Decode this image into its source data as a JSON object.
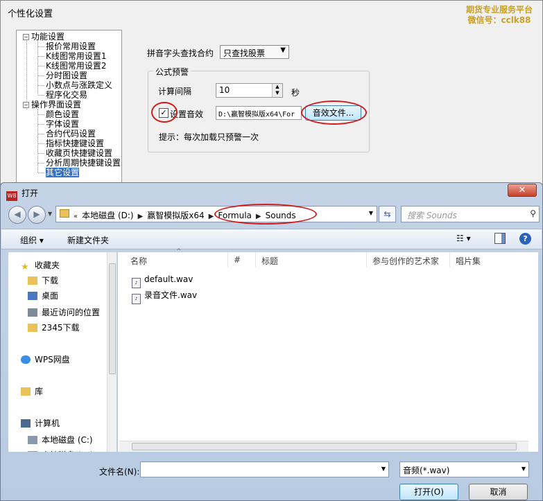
{
  "settings_window": {
    "title": "个性化设置",
    "watermark_line1": "期货专业服务平台",
    "watermark_line2": "微信号：cclk88",
    "tree": [
      {
        "label": "功能设置",
        "level": 0,
        "expander": "−"
      },
      {
        "label": "报价常用设置",
        "level": 1
      },
      {
        "label": "K线图常用设置1",
        "level": 1
      },
      {
        "label": "K线图常用设置2",
        "level": 1
      },
      {
        "label": "分时图设置",
        "level": 1
      },
      {
        "label": "小数点与涨跌定义",
        "level": 1
      },
      {
        "label": "程序化交易",
        "level": 1
      },
      {
        "label": "操作界面设置",
        "level": 0,
        "expander": "−"
      },
      {
        "label": "颜色设置",
        "level": 1
      },
      {
        "label": "字体设置",
        "level": 1
      },
      {
        "label": "合约代码设置",
        "level": 1
      },
      {
        "label": "指标快捷键设置",
        "level": 1
      },
      {
        "label": "收藏页快捷键设置",
        "level": 1
      },
      {
        "label": "分析周期快捷键设置",
        "level": 1
      },
      {
        "label": "其它设置",
        "level": 1,
        "selected": true
      }
    ],
    "pinyin_label": "拼音字头查找合约",
    "pinyin_value": "只查找股票",
    "formula_group": "公式预警",
    "interval_label": "计算间隔",
    "interval_value": "10",
    "interval_unit": "秒",
    "sound_checked": "✓",
    "sound_label": "设置音效",
    "sound_path": "D:\\赢智模拟版x64\\For",
    "sound_button": "音效文件...",
    "hint": "提示：每次加载只预警一次"
  },
  "open_dialog": {
    "title": "打开",
    "app_icon_text": "W8",
    "close_symbol": "✕",
    "breadcrumbs": [
      "«",
      "本地磁盘 (D:)",
      "▶",
      "赢智模拟版x64",
      "▶",
      "Formula",
      "▶",
      "Sounds"
    ],
    "search_placeholder": "搜索 Sounds",
    "toolbar": {
      "organize": "组织 ▾",
      "new_folder": "新建文件夹",
      "view": "☷ ▾",
      "help": "?"
    },
    "sidebar": [
      {
        "label": "收藏夹",
        "icon": "star-icon",
        "color": "#e8b820"
      },
      {
        "label": "下载",
        "icon": "download-folder-icon",
        "color": "#e9c25a"
      },
      {
        "label": "桌面",
        "icon": "desktop-icon",
        "color": "#4a78c0"
      },
      {
        "label": "最近访问的位置",
        "icon": "recent-places-icon",
        "color": "#7c8a9a"
      },
      {
        "label": "2345下载",
        "icon": "folder-icon",
        "color": "#e9c25a"
      },
      {
        "label": "WPS网盘",
        "icon": "cloud-icon",
        "color": "#3a8ee6"
      },
      {
        "label": "库",
        "icon": "library-icon",
        "color": "#e9c25a"
      },
      {
        "label": "计算机",
        "icon": "computer-icon",
        "color": "#4a6a90"
      },
      {
        "label": "本地磁盘 (C:)",
        "icon": "drive-icon",
        "color": "#8a9aae"
      },
      {
        "label": "本地磁盘 (D:)",
        "icon": "drive-icon",
        "color": "#8a9aae"
      }
    ],
    "columns": [
      "名称",
      "#",
      "标题",
      "参与创作的艺术家",
      "唱片集"
    ],
    "files": [
      "default.wav",
      "录音文件.wav"
    ],
    "filename_label": "文件名(N):",
    "filename_value": "",
    "filetype": "音频(*.wav)",
    "open_button": "打开(O)",
    "cancel_button": "取消"
  },
  "colors": {
    "annotation_red": "#d21c1c",
    "selection_blue": "#3470c4",
    "watermark": "#c8a028"
  }
}
